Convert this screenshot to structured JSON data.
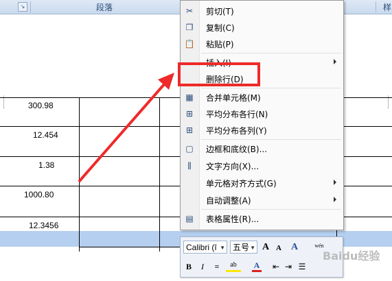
{
  "ribbon": {
    "launcher_icon": "dialog-launcher-icon",
    "group_label": "段落",
    "partial_label": "样"
  },
  "table": {
    "cells": [
      "300.98",
      "12.454",
      "1.38",
      "1000.80",
      "12.3456"
    ],
    "selected_row_color": "#b5cff0"
  },
  "context_menu": {
    "items": [
      {
        "label": "剪切(T)",
        "icon": "scissors-icon",
        "submenu": false
      },
      {
        "label": "复制(C)",
        "icon": "copy-icon",
        "submenu": false
      },
      {
        "label": "粘贴(P)",
        "icon": "paste-icon",
        "submenu": false
      },
      {
        "label": "插入(I)",
        "icon": "",
        "submenu": true
      },
      {
        "label": "删除行(D)",
        "icon": "",
        "submenu": false
      },
      {
        "label": "合并单元格(M)",
        "icon": "merge-cells-icon",
        "submenu": false
      },
      {
        "label": "平均分布各行(N)",
        "icon": "distribute-rows-icon",
        "submenu": false
      },
      {
        "label": "平均分布各列(Y)",
        "icon": "distribute-columns-icon",
        "submenu": false
      },
      {
        "label": "边框和底纹(B)...",
        "icon": "borders-icon",
        "submenu": false
      },
      {
        "label": "文字方向(X)...",
        "icon": "text-direction-icon",
        "submenu": false
      },
      {
        "label": "单元格对齐方式(G)",
        "icon": "",
        "submenu": true
      },
      {
        "label": "自动调整(A)",
        "icon": "",
        "submenu": true
      },
      {
        "label": "表格属性(R)...",
        "icon": "table-properties-icon",
        "submenu": false
      }
    ]
  },
  "annotation": {
    "highlight_color": "#ee2a2a"
  },
  "mini_toolbar": {
    "font_name": "Calibri (ī",
    "font_size": "五号",
    "grow_font": "A",
    "shrink_font": "A",
    "style_label": "A",
    "wen_label": "wén",
    "bold": "B",
    "italic": "I"
  },
  "watermark": "Baidu经验"
}
